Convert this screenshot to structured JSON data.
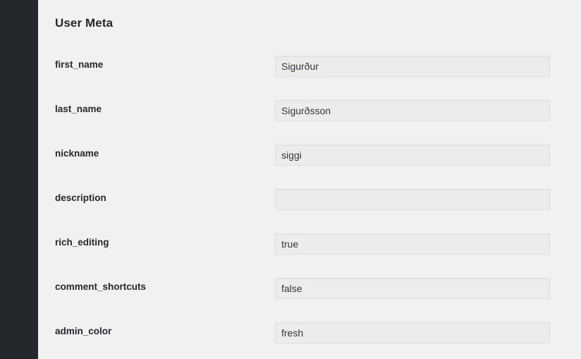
{
  "theme": {
    "sidebar_color": "#23282d",
    "page_background": "#f1f1f1",
    "field_background": "#ececec",
    "field_border": "#dfdfdf",
    "label_color": "#23282d",
    "value_color": "#32373c"
  },
  "panel": {
    "title": "User Meta"
  },
  "fields": [
    {
      "label": "first_name",
      "value": "Sigurður",
      "placeholder": ""
    },
    {
      "label": "last_name",
      "value": "Sigurðsson",
      "placeholder": ""
    },
    {
      "label": "nickname",
      "value": "siggi",
      "placeholder": ""
    },
    {
      "label": "description",
      "value": "",
      "placeholder": ""
    },
    {
      "label": "rich_editing",
      "value": "true",
      "placeholder": ""
    },
    {
      "label": "comment_shortcuts",
      "value": "false",
      "placeholder": ""
    },
    {
      "label": "admin_color",
      "value": "fresh",
      "placeholder": ""
    }
  ]
}
